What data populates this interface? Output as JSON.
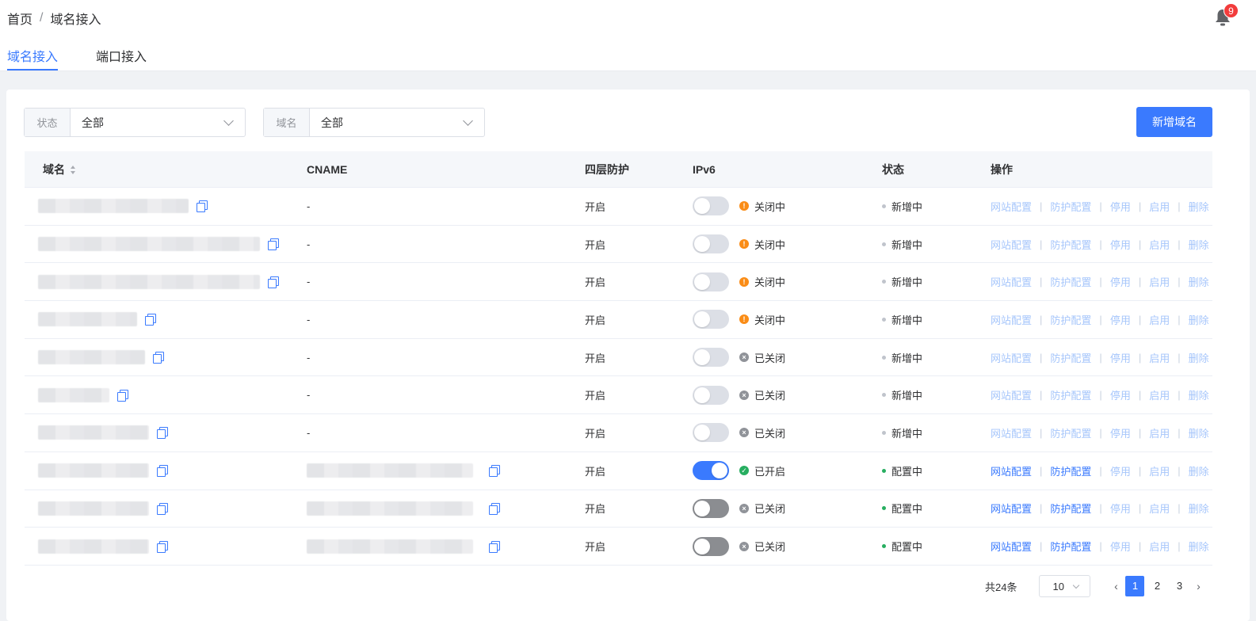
{
  "breadcrumb": {
    "home": "首页",
    "separator": "/",
    "current": "域名接入"
  },
  "notifications": {
    "count": "9",
    "icon": "bell-icon"
  },
  "tabs": [
    {
      "label": "域名接入",
      "active": true
    },
    {
      "label": "端口接入",
      "active": false
    }
  ],
  "filters": {
    "status": {
      "label": "状态",
      "value": "全部"
    },
    "domain": {
      "label": "域名",
      "value": "全部"
    }
  },
  "add_button": "新增域名",
  "table": {
    "headers": {
      "domain": "域名",
      "cname": "CNAME",
      "l4": "四层防护",
      "ipv6": "IPv6",
      "status": "状态",
      "ops": "操作"
    },
    "rows": [
      {
        "cname": "-",
        "l4": "开启",
        "ipv6_on": false,
        "ipv6_status": "关闭中",
        "ipv6_kind": "warn",
        "status": "新增中",
        "status_kind": "gray",
        "ops_enabled": false
      },
      {
        "cname": "-",
        "l4": "开启",
        "ipv6_on": false,
        "ipv6_status": "关闭中",
        "ipv6_kind": "warn",
        "status": "新增中",
        "status_kind": "gray",
        "ops_enabled": false
      },
      {
        "cname": "-",
        "l4": "开启",
        "ipv6_on": false,
        "ipv6_status": "关闭中",
        "ipv6_kind": "warn",
        "status": "新增中",
        "status_kind": "gray",
        "ops_enabled": false
      },
      {
        "cname": "-",
        "l4": "开启",
        "ipv6_on": false,
        "ipv6_status": "关闭中",
        "ipv6_kind": "warn",
        "status": "新增中",
        "status_kind": "gray",
        "ops_enabled": false
      },
      {
        "cname": "-",
        "l4": "开启",
        "ipv6_on": false,
        "ipv6_status": "已关闭",
        "ipv6_kind": "off",
        "status": "新增中",
        "status_kind": "gray",
        "ops_enabled": false
      },
      {
        "cname": "-",
        "l4": "开启",
        "ipv6_on": false,
        "ipv6_status": "已关闭",
        "ipv6_kind": "off",
        "status": "新增中",
        "status_kind": "gray",
        "ops_enabled": false
      },
      {
        "cname": "-",
        "l4": "开启",
        "ipv6_on": false,
        "ipv6_status": "已关闭",
        "ipv6_kind": "off",
        "status": "新增中",
        "status_kind": "gray",
        "ops_enabled": false
      },
      {
        "cname": "",
        "l4": "开启",
        "ipv6_on": true,
        "ipv6_status": "已开启",
        "ipv6_kind": "ok",
        "status": "配置中",
        "status_kind": "green",
        "ops_enabled": true
      },
      {
        "cname": "",
        "l4": "开启",
        "ipv6_on": false,
        "ipv6_status": "已关闭",
        "ipv6_kind": "off",
        "status": "配置中",
        "status_kind": "green",
        "ops_enabled": true
      },
      {
        "cname": "",
        "l4": "开启",
        "ipv6_on": false,
        "ipv6_status": "已关闭",
        "ipv6_kind": "off",
        "status": "配置中",
        "status_kind": "green",
        "ops_enabled": true
      }
    ],
    "ops_labels": [
      "网站配置",
      "防护配置",
      "停用",
      "启用",
      "删除"
    ]
  },
  "pagination": {
    "total": "共24条",
    "page_size": "10",
    "pages": [
      "1",
      "2",
      "3"
    ],
    "current": "1"
  },
  "colors": {
    "primary": "#3a7afe",
    "warn": "#fa8c16",
    "success": "#27ae60",
    "muted": "#909399"
  }
}
